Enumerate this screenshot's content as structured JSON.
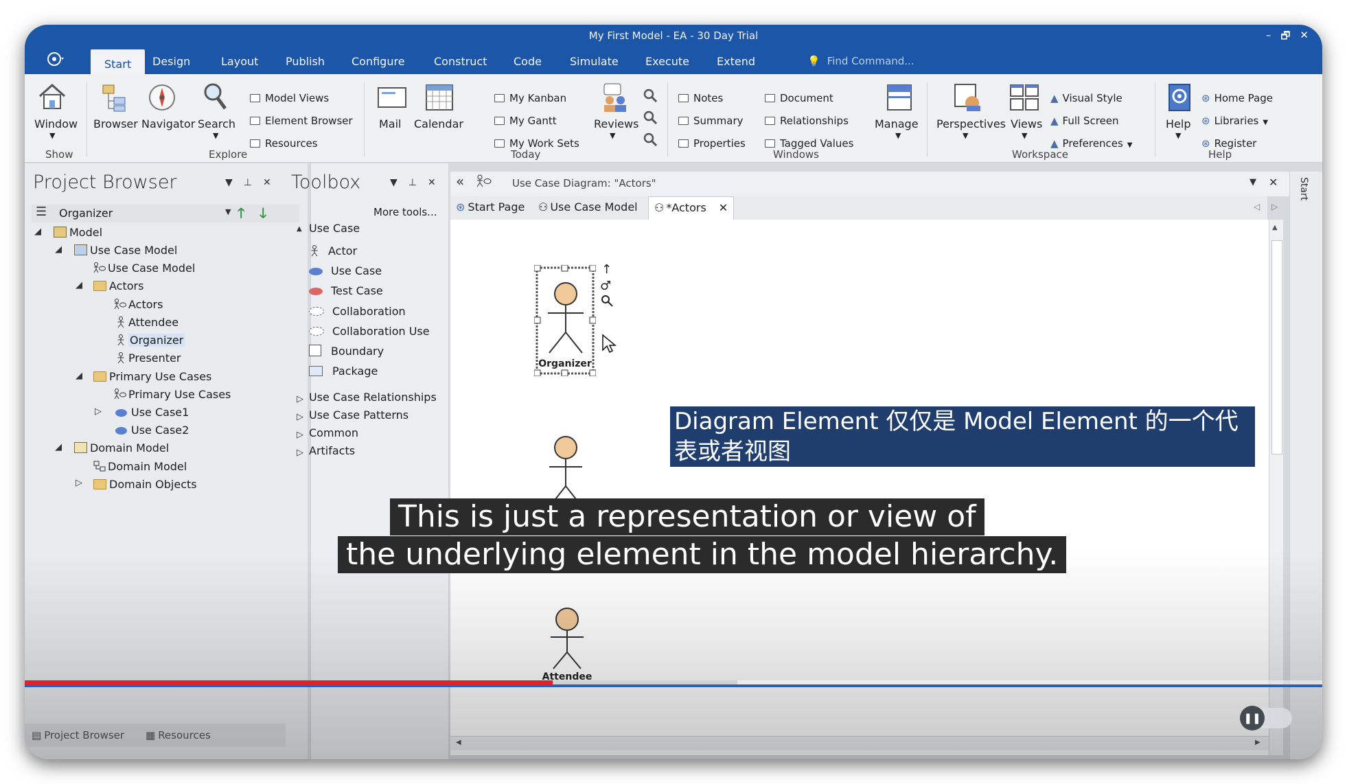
{
  "window": {
    "title": "My First Model - EA - 30 Day Trial",
    "controls": [
      "–",
      "🗗",
      "✕"
    ]
  },
  "menu": {
    "tabs": [
      "Start",
      "Design",
      "Layout",
      "Publish",
      "Configure",
      "Construct",
      "Code",
      "Simulate",
      "Execute",
      "Extend"
    ],
    "active": "Start",
    "find_placeholder": "Find Command..."
  },
  "ribbon": {
    "show": {
      "window": "Window",
      "group": "Show"
    },
    "explore": {
      "browser": "Browser",
      "navigator": "Navigator",
      "search": "Search",
      "model_views": "Model Views",
      "element_browser": "Element Browser",
      "resources": "Resources",
      "group": "Explore"
    },
    "today": {
      "mail": "Mail",
      "calendar": "Calendar",
      "my_kanban": "My Kanban",
      "my_gantt": "My Gantt",
      "my_work_sets": "My Work Sets",
      "reviews": "Reviews",
      "group": "Today"
    },
    "windows": {
      "notes": "Notes",
      "summary": "Summary",
      "properties": "Properties",
      "document": "Document",
      "relationships": "Relationships",
      "tagged_values": "Tagged Values",
      "manage": "Manage",
      "group": "Windows"
    },
    "workspace": {
      "perspectives": "Perspectives",
      "views": "Views",
      "visual_style": "Visual Style",
      "full_screen": "Full Screen",
      "preferences": "Preferences",
      "group": "Workspace"
    },
    "help": {
      "help": "Help",
      "home_page": "Home Page",
      "libraries": "Libraries",
      "register": "Register",
      "group": "Help"
    }
  },
  "project_browser": {
    "title": "Project Browser",
    "toolbar_label": "Organizer",
    "items": [
      {
        "label": "Model",
        "kind": "root"
      },
      {
        "label": "Use Case Model",
        "kind": "package"
      },
      {
        "label": "Use Case Model",
        "kind": "diagram"
      },
      {
        "label": "Actors",
        "kind": "folder"
      },
      {
        "label": "Actors",
        "kind": "diagram"
      },
      {
        "label": "Attendee",
        "kind": "actor"
      },
      {
        "label": "Organizer",
        "kind": "actor"
      },
      {
        "label": "Presenter",
        "kind": "actor"
      },
      {
        "label": "Primary Use Cases",
        "kind": "folder"
      },
      {
        "label": "Primary Use Cases",
        "kind": "diagram"
      },
      {
        "label": "Use Case1",
        "kind": "usecase"
      },
      {
        "label": "Use Case2",
        "kind": "usecase"
      },
      {
        "label": "Domain Model",
        "kind": "package"
      },
      {
        "label": "Domain Model",
        "kind": "diagram"
      },
      {
        "label": "Domain Objects",
        "kind": "folder"
      }
    ],
    "bottom_tabs": [
      "Project Browser",
      "Resources"
    ]
  },
  "toolbox": {
    "title": "Toolbox",
    "more_tools": "More tools...",
    "section": "Use Case",
    "items": [
      "Actor",
      "Use Case",
      "Test Case",
      "Collaboration",
      "Collaboration Use",
      "Boundary",
      "Package"
    ],
    "groups": [
      "Use Case Relationships",
      "Use Case Patterns",
      "Common",
      "Artifacts"
    ]
  },
  "diagram": {
    "header": "Use Case Diagram: \"Actors\"",
    "tabs": [
      "Start Page",
      "Use Case Model",
      "*Actors"
    ],
    "actors": [
      "Organizer",
      "Attendee"
    ],
    "side_tab": "Start"
  },
  "subtitles": {
    "chinese": "Diagram Element 仅仅是 Model Element 的一个代表或者视图",
    "english_line1": "This is just a representation or view of",
    "english_line2": "the underlying element in the model hierarchy."
  },
  "player": {
    "progress_played": 0.407,
    "progress_buffered": 0.549
  }
}
